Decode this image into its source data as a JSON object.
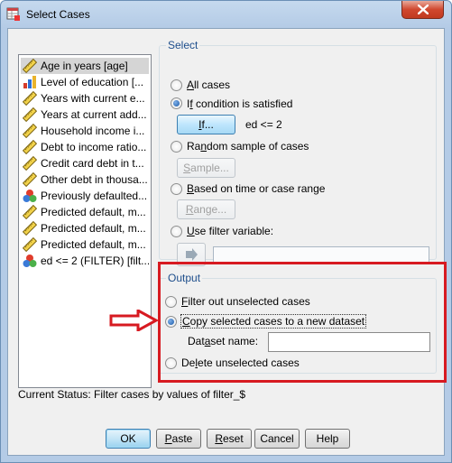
{
  "window": {
    "title": "Select Cases"
  },
  "variables": [
    {
      "label": "Age in years [age]",
      "icon": "scale-ruler-icon"
    },
    {
      "label": "Level of education [...",
      "icon": "ordinal-bars-icon"
    },
    {
      "label": "Years with current e...",
      "icon": "scale-ruler-icon"
    },
    {
      "label": "Years at current add...",
      "icon": "scale-ruler-icon"
    },
    {
      "label": "Household income i...",
      "icon": "scale-ruler-icon"
    },
    {
      "label": "Debt to income ratio...",
      "icon": "scale-ruler-icon"
    },
    {
      "label": "Credit card debt in t...",
      "icon": "scale-ruler-icon"
    },
    {
      "label": "Other debt in thousa...",
      "icon": "scale-ruler-icon"
    },
    {
      "label": "Previously defaulted...",
      "icon": "nominal-circles-icon"
    },
    {
      "label": "Predicted default, m...",
      "icon": "scale-ruler-icon"
    },
    {
      "label": "Predicted default, m...",
      "icon": "scale-ruler-icon"
    },
    {
      "label": "Predicted default, m...",
      "icon": "scale-ruler-icon"
    },
    {
      "label": "ed <= 2 (FILTER) [filt...",
      "icon": "nominal-circles-icon"
    }
  ],
  "select": {
    "legend": "Select",
    "all_cases": "All cases",
    "if_condition": "If condition is satisfied",
    "if_button": "If...",
    "condition_text": "ed <= 2",
    "random_sample": "Random sample of cases",
    "sample_button": "Sample...",
    "time_range": "Based on time or case range",
    "range_button": "Range...",
    "filter_variable": "Use filter variable:",
    "filter_value": ""
  },
  "output": {
    "legend": "Output",
    "filter_out": "Filter out unselected cases",
    "copy_dataset": "Copy selected cases to a new dataset",
    "dataset_name_label": "Dataset name:",
    "dataset_name_value": "",
    "delete_unselected": "Delete unselected cases"
  },
  "status": "Current Status: Filter cases by values of filter_$",
  "buttons": {
    "ok": "OK",
    "paste": "Paste",
    "reset": "Reset",
    "cancel": "Cancel",
    "help": "Help"
  },
  "colors": {
    "highlight": "#d71a21",
    "legend_text": "#1e4e8c",
    "selection": "#d5d5d5"
  }
}
